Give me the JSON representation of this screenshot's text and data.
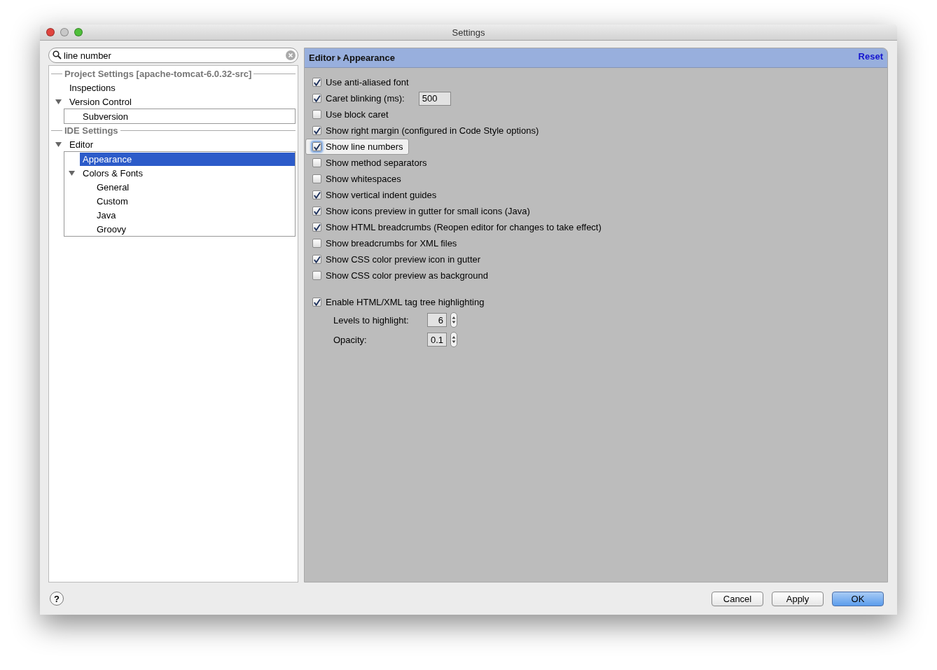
{
  "window": {
    "title": "Settings"
  },
  "search": {
    "value": "line number"
  },
  "tree": [
    {
      "kind": "header",
      "label": "Project Settings [apache-tomcat-6.0.32-src]"
    },
    {
      "kind": "item",
      "label": "Inspections",
      "selected": false
    },
    {
      "kind": "item",
      "label": "Version Control",
      "selected": false,
      "expanded": true,
      "children": [
        {
          "label": "Subversion",
          "selected": false
        }
      ]
    },
    {
      "kind": "header",
      "label": "IDE Settings"
    },
    {
      "kind": "item",
      "label": "Editor",
      "selected": false,
      "expanded": true,
      "children": [
        {
          "label": "Appearance",
          "selected": true
        },
        {
          "label": "Colors & Fonts",
          "selected": false,
          "expanded": true,
          "children": [
            {
              "label": "General",
              "selected": false
            },
            {
              "label": "Custom",
              "selected": false
            },
            {
              "label": "Java",
              "selected": false
            },
            {
              "label": "Groovy",
              "selected": false
            }
          ]
        }
      ]
    }
  ],
  "breadcrumb": [
    "Editor",
    "Appearance"
  ],
  "reset": "Reset",
  "options": [
    {
      "kind": "checkbox",
      "label": "Use anti-aliased font",
      "checked": true,
      "focused": false
    },
    {
      "kind": "checkbox",
      "label": "Caret blinking (ms):",
      "checked": true,
      "focused": false,
      "value": "500"
    },
    {
      "kind": "checkbox",
      "label": "Use block caret",
      "checked": false,
      "focused": false
    },
    {
      "kind": "checkbox",
      "label": "Show right margin (configured in Code Style options)",
      "checked": true,
      "focused": false
    },
    {
      "kind": "checkbox",
      "label": "Show line numbers",
      "checked": true,
      "focused": true
    },
    {
      "kind": "checkbox",
      "label": "Show method separators",
      "checked": false,
      "focused": false
    },
    {
      "kind": "checkbox",
      "label": "Show whitespaces",
      "checked": false,
      "focused": false
    },
    {
      "kind": "checkbox",
      "label": "Show vertical indent guides",
      "checked": true,
      "focused": false
    },
    {
      "kind": "checkbox",
      "label": "Show icons preview in gutter for small icons (Java)",
      "checked": true,
      "focused": false
    },
    {
      "kind": "checkbox",
      "label": "Show HTML breadcrumbs (Reopen editor for changes to take effect)",
      "checked": true,
      "focused": false
    },
    {
      "kind": "checkbox",
      "label": "Show breadcrumbs for XML files",
      "checked": false,
      "focused": false
    },
    {
      "kind": "checkbox",
      "label": "Show CSS color preview icon in gutter",
      "checked": true,
      "focused": false
    },
    {
      "kind": "checkbox",
      "label": "Show CSS color preview as background",
      "checked": false,
      "focused": false
    },
    {
      "kind": "gap"
    },
    {
      "kind": "checkbox",
      "label": "Enable HTML/XML tag tree highlighting",
      "checked": true,
      "focused": false
    },
    {
      "kind": "spinner",
      "label": "Levels to highlight:",
      "value": "6"
    },
    {
      "kind": "spinner",
      "label": "Opacity:",
      "value": "0.1"
    }
  ],
  "help": "?",
  "buttons": [
    {
      "label": "Cancel",
      "default": false
    },
    {
      "label": "Apply",
      "default": false
    },
    {
      "label": "OK",
      "default": true
    }
  ]
}
